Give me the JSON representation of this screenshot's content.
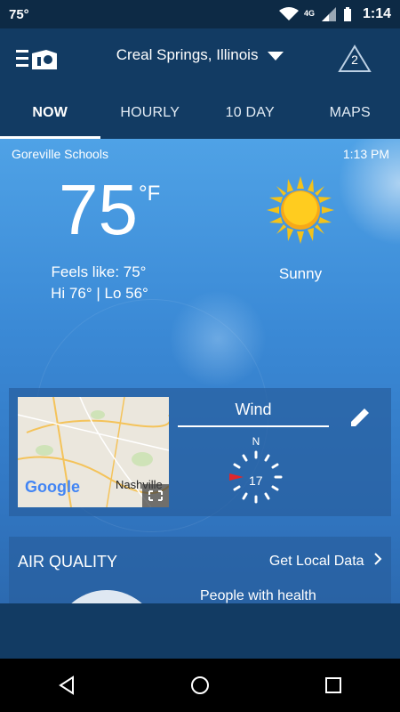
{
  "status": {
    "temp": "75°",
    "network": "4G LTE",
    "time": "1:14"
  },
  "header": {
    "location": "Creal Springs, Illinois",
    "alert_count": "2"
  },
  "tabs": [
    {
      "label": "NOW",
      "active": true
    },
    {
      "label": "HOURLY",
      "active": false
    },
    {
      "label": "10 DAY",
      "active": false
    },
    {
      "label": "MAPS",
      "active": false
    }
  ],
  "current": {
    "station": "Goreville Schools",
    "time": "1:13 PM",
    "temp": "75",
    "unit": "°F",
    "feels_like": "Feels like: 75°",
    "hi_lo": "Hi 76° | Lo 56°",
    "condition": "Sunny",
    "icon": "sun-icon"
  },
  "map_card": {
    "google_label": "Google",
    "city_label": "Nashville",
    "wind_title": "Wind",
    "wind_dir_label": "N",
    "wind_speed": "17"
  },
  "air_quality": {
    "title": "AIR QUALITY",
    "link": "Get Local Data",
    "desc": "People with health"
  },
  "colors": {
    "header": "#123b63",
    "sky": "#3b8ad6",
    "accent": "#e0262b"
  }
}
